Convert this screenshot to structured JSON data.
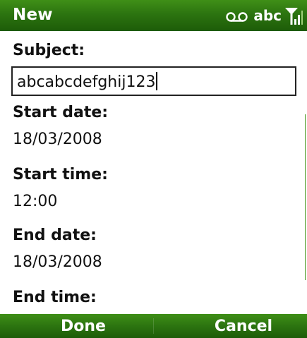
{
  "titlebar": {
    "title": "New",
    "status": {
      "voicemail_icon": "voicemail-icon",
      "input_mode": "abc",
      "signal_icon": "signal-strength-icon"
    }
  },
  "form": {
    "subject_label": "Subject:",
    "subject_value": "abcabcdefghij123",
    "start_date_label": "Start date:",
    "start_date_value": "18/03/2008",
    "start_time_label": "Start time:",
    "start_time_value": "12:00",
    "end_date_label": "End date:",
    "end_date_value": "18/03/2008",
    "end_time_label": "End time:"
  },
  "softkeys": {
    "left_label": "Done",
    "right_label": "Cancel"
  },
  "colors": {
    "bar_green": "#2c7410",
    "text": "#111111",
    "background": "#ffffff"
  }
}
